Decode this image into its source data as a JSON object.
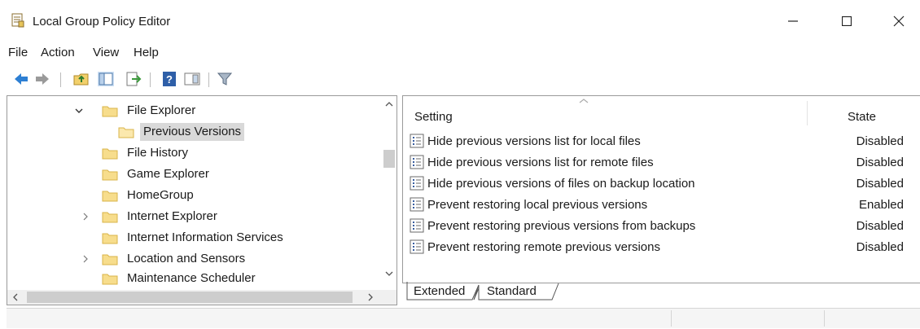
{
  "window": {
    "title": "Local Group Policy Editor"
  },
  "menu": [
    "File",
    "Action",
    "View",
    "Help"
  ],
  "toolbar": [
    "back-arrow-icon",
    "forward-arrow-icon",
    "up-folder-icon",
    "show-hide-tree-icon",
    "export-list-icon",
    "help-icon",
    "properties-pane-icon",
    "filter-icon"
  ],
  "tree": {
    "items": [
      {
        "label": "File Explorer",
        "expanded": true,
        "selected": false
      },
      {
        "label": "Previous Versions",
        "expanded": false,
        "selected": true
      },
      {
        "label": "File History",
        "expanded": false,
        "selected": false
      },
      {
        "label": "Game Explorer",
        "expanded": false,
        "selected": false
      },
      {
        "label": "HomeGroup",
        "expanded": false,
        "selected": false
      },
      {
        "label": "Internet Explorer",
        "expanded": false,
        "selected": false
      },
      {
        "label": "Internet Information Services",
        "expanded": false,
        "selected": false
      },
      {
        "label": "Location and Sensors",
        "expanded": false,
        "selected": false
      },
      {
        "label": "Maintenance Scheduler",
        "expanded": false,
        "selected": false
      }
    ]
  },
  "list": {
    "columns": {
      "setting": "Setting",
      "state": "State"
    },
    "rows": [
      {
        "setting": "Hide previous versions list for local files",
        "state": "Disabled"
      },
      {
        "setting": "Hide previous versions list for remote files",
        "state": "Disabled"
      },
      {
        "setting": "Hide previous versions of files on backup location",
        "state": "Disabled"
      },
      {
        "setting": "Prevent restoring local previous versions",
        "state": "Enabled"
      },
      {
        "setting": "Prevent restoring previous versions from backups",
        "state": "Disabled"
      },
      {
        "setting": "Prevent restoring remote previous versions",
        "state": "Disabled"
      }
    ]
  },
  "tabs": {
    "extended": "Extended",
    "standard": "Standard",
    "active": "Standard"
  },
  "colors": {
    "folder_fill": "#f7dd8c",
    "folder_edge": "#d9b44a",
    "selection": "#d9d9d9",
    "arrow_blue": "#2d7fd3"
  }
}
